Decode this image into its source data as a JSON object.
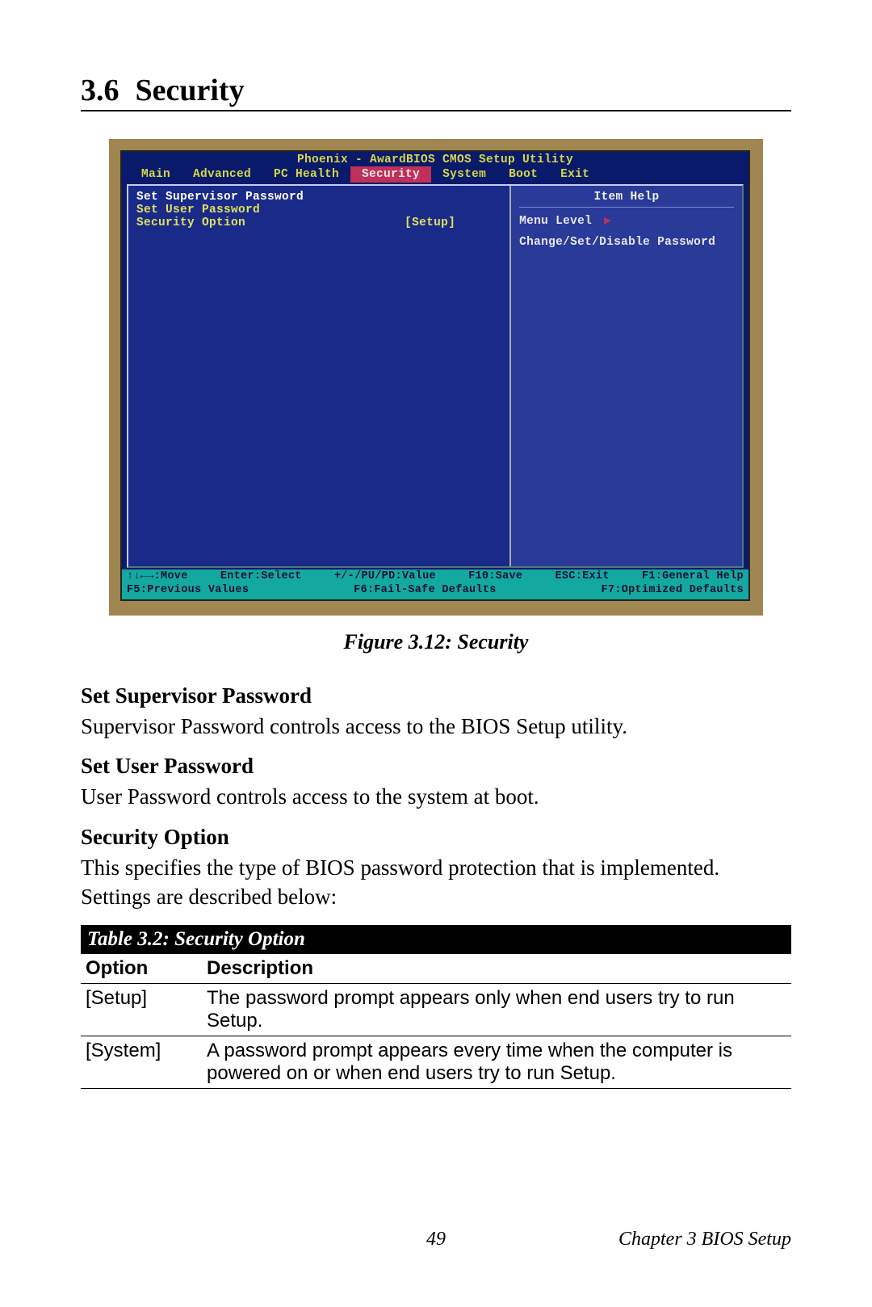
{
  "section": {
    "number": "3.6",
    "title": "Security"
  },
  "bios": {
    "title": "Phoenix - AwardBIOS CMOS Setup Utility",
    "tabs": [
      "Main",
      "Advanced",
      "PC Health",
      "Security",
      "System",
      "Boot",
      "Exit"
    ],
    "active_tab": "Security",
    "left": {
      "items": [
        {
          "label": "Set Supervisor Password",
          "value": "",
          "highlight": true
        },
        {
          "label": "Set User Password",
          "value": ""
        },
        {
          "label": "Security Option",
          "value": "[Setup]"
        }
      ]
    },
    "right": {
      "heading": "Item Help",
      "menu_level_label": "Menu Level",
      "help_text": "Change/Set/Disable Password"
    },
    "footer": {
      "row1": [
        "↑↓←→:Move",
        "Enter:Select",
        "+/-/PU/PD:Value",
        "F10:Save",
        "ESC:Exit",
        "F1:General Help"
      ],
      "row2": [
        "F5:Previous Values",
        "F6:Fail-Safe Defaults",
        "F7:Optimized Defaults"
      ]
    }
  },
  "figure_caption": "Figure 3.12: Security",
  "terms": [
    {
      "heading": "Set Supervisor Password",
      "body": "Supervisor Password controls access to the BIOS Setup utility."
    },
    {
      "heading": "Set User Password",
      "body": "User Password controls access to the system at boot."
    },
    {
      "heading": "Security Option",
      "body": "This specifies the type of BIOS password protection that is implemented. Settings are described below:"
    }
  ],
  "table": {
    "title": "Table 3.2: Security Option",
    "headers": [
      "Option",
      "Description"
    ],
    "rows": [
      {
        "option": "[Setup]",
        "desc": "The password prompt appears only when end users try to run Setup."
      },
      {
        "option": "[System]",
        "desc": "A password prompt appears every time when the computer  is powered on or when end users try to run Setup."
      }
    ]
  },
  "footer": {
    "page": "49",
    "chapter": "Chapter 3  BIOS Setup"
  }
}
